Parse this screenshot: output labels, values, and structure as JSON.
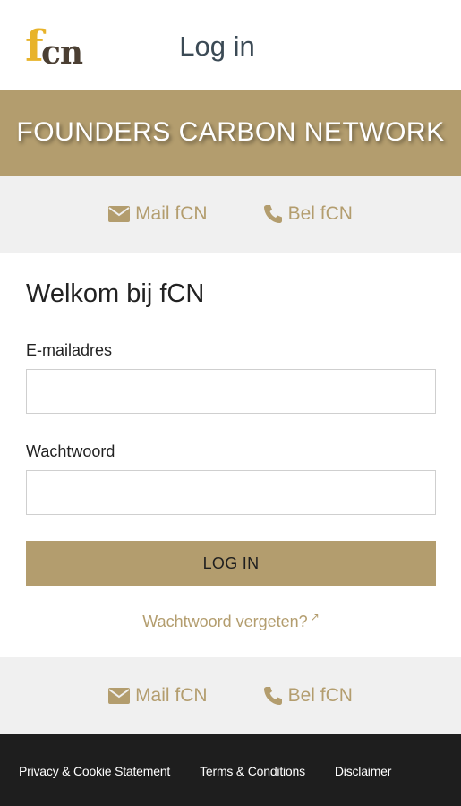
{
  "header": {
    "logo_f": "f",
    "logo_cn": "cn",
    "title": "Log in"
  },
  "brand": {
    "name": "FOUNDERS CARBON NETWORK"
  },
  "contact": {
    "mail_label": "Mail fCN",
    "call_label": "Bel fCN"
  },
  "form": {
    "welcome": "Welkom bij fCN",
    "email_label": "E-mailadres",
    "email_value": "",
    "password_label": "Wachtwoord",
    "password_value": "",
    "submit_label": "LOG IN",
    "forgot_label": "Wachtwoord vergeten?"
  },
  "footer": {
    "links": [
      "Privacy & Cookie Statement",
      "Terms & Conditions",
      "Disclaimer"
    ]
  },
  "colors": {
    "accent": "#b39d6e",
    "logo_yellow": "#e8b32a",
    "footer_bg": "#1e1e1e",
    "contact_bg": "#f0f0f0"
  },
  "icons": [
    "envelope-icon",
    "phone-icon",
    "external-link-icon"
  ]
}
